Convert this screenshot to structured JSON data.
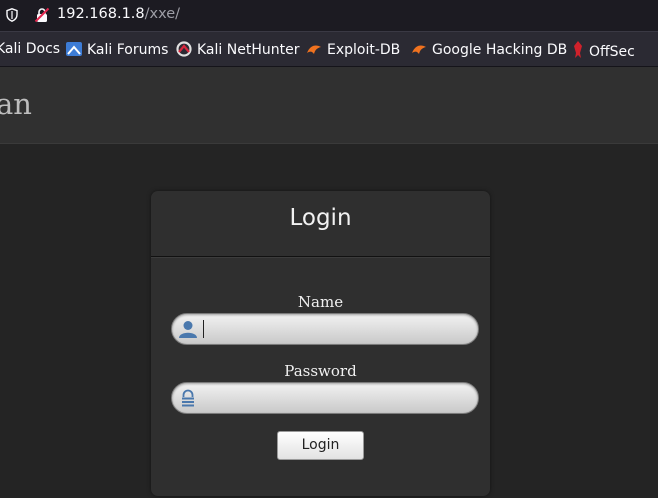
{
  "browser": {
    "url_host": "192.168.1.8",
    "url_path": "/xxe/",
    "bookmarks": [
      {
        "label": "Kali Docs",
        "icon": "kali-docs-icon"
      },
      {
        "label": "Kali Forums",
        "icon": "kali-forums-icon"
      },
      {
        "label": "Kali NetHunter",
        "icon": "kali-nethunter-icon"
      },
      {
        "label": "Exploit-DB",
        "icon": "exploit-db-icon"
      },
      {
        "label": "Google Hacking DB",
        "icon": "google-hacking-db-icon"
      },
      {
        "label": "OffSec",
        "icon": "offsec-icon"
      }
    ]
  },
  "site": {
    "title": "an"
  },
  "login": {
    "title": "Login",
    "name_label": "Name",
    "name_value": "",
    "password_label": "Password",
    "password_value": "",
    "button_label": "Login"
  }
}
